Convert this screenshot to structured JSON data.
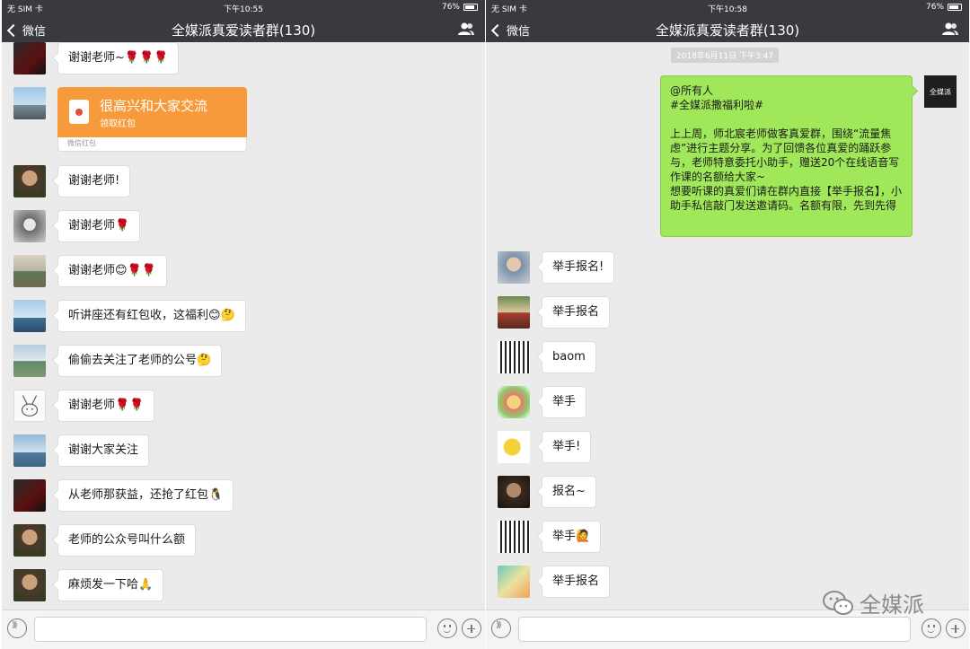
{
  "status_left": {
    "carrier": "无 SIM 卡",
    "time": "下午10:55",
    "battery": "76%"
  },
  "status_right": {
    "carrier": "无 SIM 卡",
    "time": "下午10:58",
    "battery": "76%"
  },
  "nav": {
    "back_label": "微信",
    "title": "全媒派真爱读者群(130)"
  },
  "left_messages": [
    {
      "text": "谢谢老师~🌹🌹🌹"
    },
    {
      "text": "谢谢老师!"
    },
    {
      "text": "谢谢老师🌹"
    },
    {
      "text": "谢谢老师😊🌹🌹"
    },
    {
      "text": "听讲座还有红包收，这福利😊🤔"
    },
    {
      "text": "偷偷去关注了老师的公号🤔"
    },
    {
      "text": "谢谢老师🌹🌹"
    },
    {
      "text": "谢谢大家关注"
    },
    {
      "text": "从老师那获益，还抢了红包🐧"
    },
    {
      "text": "老师的公众号叫什么额"
    },
    {
      "text": "麻烦发一下哈🙏"
    }
  ],
  "red_packet": {
    "title": "很高兴和大家交流",
    "subtitle": "领取红包",
    "footer": "微信红包"
  },
  "right_timestamp": "2018年6月11日 下午3:47",
  "announcement": {
    "line1": "@所有人",
    "line2": "#全媒派撒福利啦#",
    "body": "上上周，师北宸老师做客真爱群，围绕“流量焦虑”进行主题分享。为了回馈各位真爱的踊跃参与，老师特意委托小助手，赠送20个在线语音写作课的名额给大家~\n想要听课的真爱们请在群内直接【举手报名】，小助手私信敲门发送邀请码。名额有限，先到先得",
    "avatar_text": "全媒派"
  },
  "right_messages": [
    {
      "text": "举手报名!"
    },
    {
      "text": "举手报名"
    },
    {
      "text": "baom"
    },
    {
      "text": "举手"
    },
    {
      "text": "举手!"
    },
    {
      "text": "报名~"
    },
    {
      "text": "举手🙋"
    },
    {
      "text": "举手报名"
    }
  ],
  "watermark": "全媒派",
  "colors": {
    "nav_bg": "#393a3f",
    "chat_bg": "#ebebeb",
    "bubble_green": "#a0e75a",
    "red_packet": "#f79a3b"
  }
}
